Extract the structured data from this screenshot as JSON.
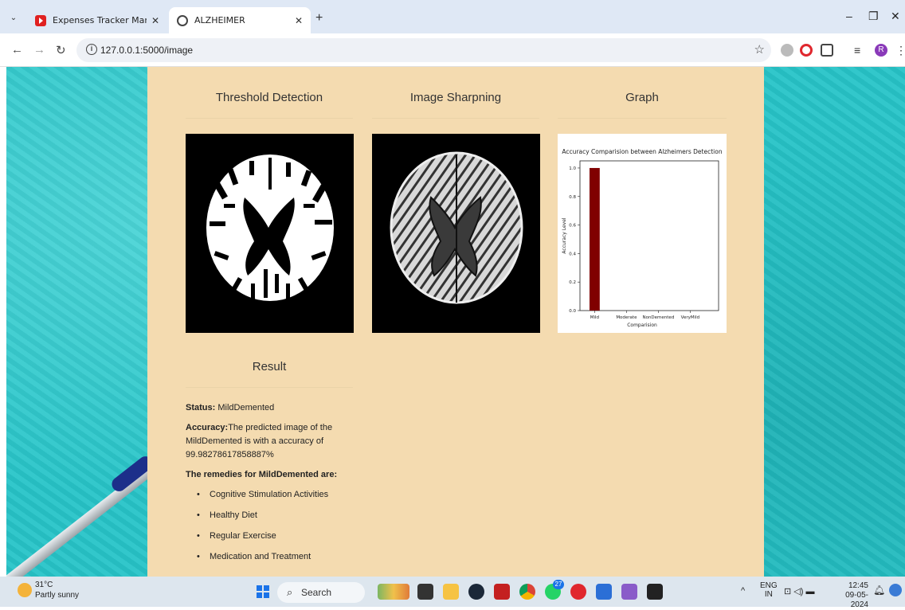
{
  "browser": {
    "tabs": [
      {
        "title": "Expenses Tracker Management",
        "active": false,
        "icon": "youtube-icon"
      },
      {
        "title": "ALZHEIMER",
        "active": true,
        "icon": "globe-icon"
      }
    ],
    "url": "127.0.0.1:5000/image"
  },
  "page": {
    "sections": {
      "threshold": "Threshold Detection",
      "sharpening": "Image Sharpning",
      "graph": "Graph",
      "result": "Result"
    },
    "result": {
      "status_label": "Status:",
      "status_value": " MildDemented",
      "accuracy_label": "Accuracy:",
      "accuracy_text": "The predicted image of the MildDemented is with a accuracy of 99.98278617858887%",
      "remedies_heading": "The remedies for MildDemented are:",
      "remedies": [
        "Cognitive Stimulation Activities",
        "Healthy Diet",
        "Regular Exercise",
        "Medication and Treatment"
      ]
    }
  },
  "chart_data": {
    "type": "bar",
    "title": "Accuracy Comparision between Alzheimers Detection",
    "xlabel": "Comparision",
    "ylabel": "Accuracy Level",
    "categories": [
      "Mild",
      "Moderate",
      "NonDemented",
      "VeryMild"
    ],
    "values": [
      1.0,
      0,
      0,
      0
    ],
    "ylim": [
      0,
      1.05
    ],
    "yticks": [
      "0.0",
      "0.2",
      "0.4",
      "0.6",
      "0.8",
      "1.0"
    ],
    "bar_color": "#800000"
  },
  "taskbar": {
    "weather_temp": "31°C",
    "weather_desc": "Partly sunny",
    "search_label": "Search",
    "lang_line1": "ENG",
    "lang_line2": "IN",
    "time": "12:45",
    "date": "09-05-2024",
    "whatsapp_badge": "27"
  }
}
